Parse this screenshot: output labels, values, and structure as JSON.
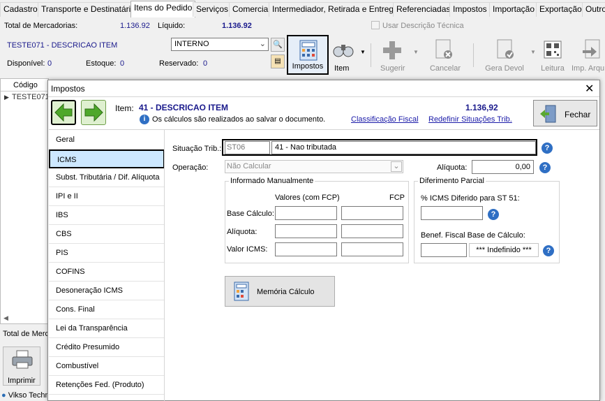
{
  "tabs": [
    "Cadastro",
    "Transporte e Destinatário",
    "Itens do Pedido",
    "Serviços",
    "Comercial",
    "Intermediador, Retirada e Entrega",
    "Referenciadas",
    "Impostos",
    "Importação",
    "Exportação",
    "Outro"
  ],
  "summary": {
    "total_mercadorias_label": "Total de Mercadorias:",
    "total_mercadorias": "1.136.92",
    "liquido_label": "Líquido:",
    "liquido": "1.136.92",
    "usar_desc_label": "Usar Descrição Técnica"
  },
  "item": {
    "name": "TESTE071 - DESCRICAO ITEM",
    "disponivel_label": "Disponível:",
    "disponivel": "0",
    "estoque_label": "Estoque:",
    "estoque": "0",
    "reservado_label": "Reservado:",
    "reservado": "0",
    "deposito": "INTERNO"
  },
  "toolbar": {
    "impostos": "Impostos",
    "item": "Item",
    "sugerir": "Sugerir",
    "cancelar": "Cancelar",
    "gera_devol": "Gera Devol",
    "leitura": "Leitura",
    "imp_arqu": "Imp. Arqu"
  },
  "grid": {
    "col_codigo": "Código",
    "row1": "TESTE071"
  },
  "bottom": {
    "total_merc": "Total de Merc",
    "imprimir": "Imprimir",
    "status": "Vikso Techn"
  },
  "dialog": {
    "title": "Impostos",
    "item_label": "Item:",
    "item_value": "41 - DESCRICAO ITEM",
    "total": "1.136,92",
    "info": "Os cálculos são realizados ao salvar o documento.",
    "link_class": "Classificação Fiscal",
    "link_redef": "Redefinir Situações Trib.",
    "fechar": "Fechar",
    "sidebar": [
      "Geral",
      "ICMS",
      "Subst. Tributária / Dif. Alíquota",
      "IPI e II",
      "IBS",
      "CBS",
      "PIS",
      "COFINS",
      "Desoneração ICMS",
      "Cons. Final",
      "Lei da Transparência",
      "Crédito Presumido",
      "Combustível",
      "Retenções Fed. (Produto)"
    ],
    "situacao_label": "Situação Trib.:",
    "situacao_code": "ST06",
    "situacao_desc": "41 - Nao tributada",
    "operacao_label": "Operação:",
    "operacao_value": "Não Calcular",
    "aliquota_label": "Alíquota:",
    "aliquota_value": "0,00",
    "manual_title": "Informado Manualmente",
    "valores_label": "Valores (com FCP)",
    "fcp_label": "FCP",
    "base_label": "Base Cálculo:",
    "aliq_label": "Alíquota:",
    "valor_label": "Valor ICMS:",
    "diferimento_title": "Diferimento Parcial",
    "diferido_label": "% ICMS Diferido para ST 51:",
    "benef_label": "Benef. Fiscal Base de Cálculo:",
    "indefinido": "*** Indefinido ***",
    "memoria": "Memória Cálculo"
  }
}
